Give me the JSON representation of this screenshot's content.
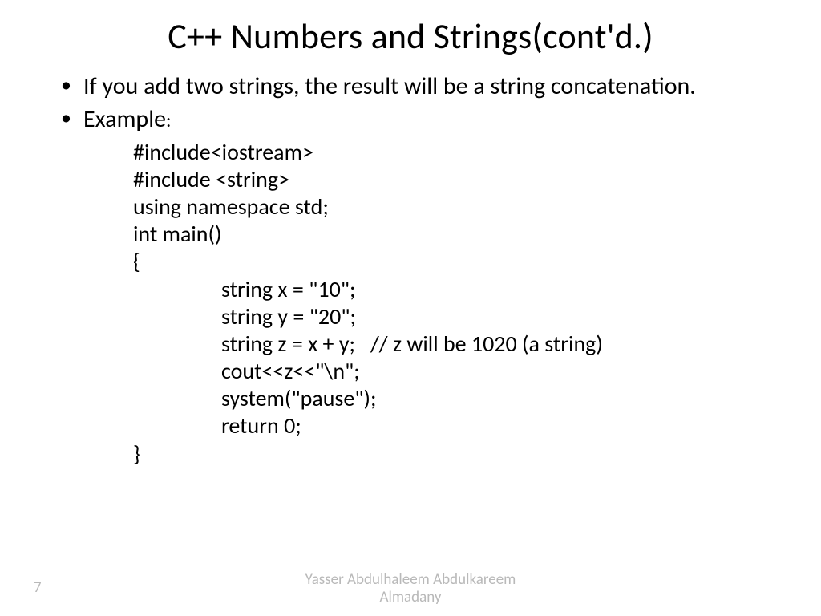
{
  "title": "C++ Numbers and Strings(cont'd.)",
  "bullets": {
    "b1": "If you add two strings, the result will be a string concatenation.",
    "b2_main": "Example",
    "b2_colon": ":"
  },
  "code": {
    "l1": "#include<iostream>",
    "l2": "#include <string>",
    "l3": "using namespace std;",
    "l4": "int main()",
    "l5": "{",
    "l6": "string x = \"10\";",
    "l7": "string y = \"20\";",
    "l8": "string z = x + y;   // z will be 1020 (a string)",
    "l9": "cout<<z<<\"\\n\";",
    "l10": "system(\"pause\");",
    "l11": "return 0;",
    "l12": "}"
  },
  "footer": {
    "page": "7",
    "author_l1": "Yasser Abdulhaleem Abdulkareem",
    "author_l2": "Almadany"
  }
}
